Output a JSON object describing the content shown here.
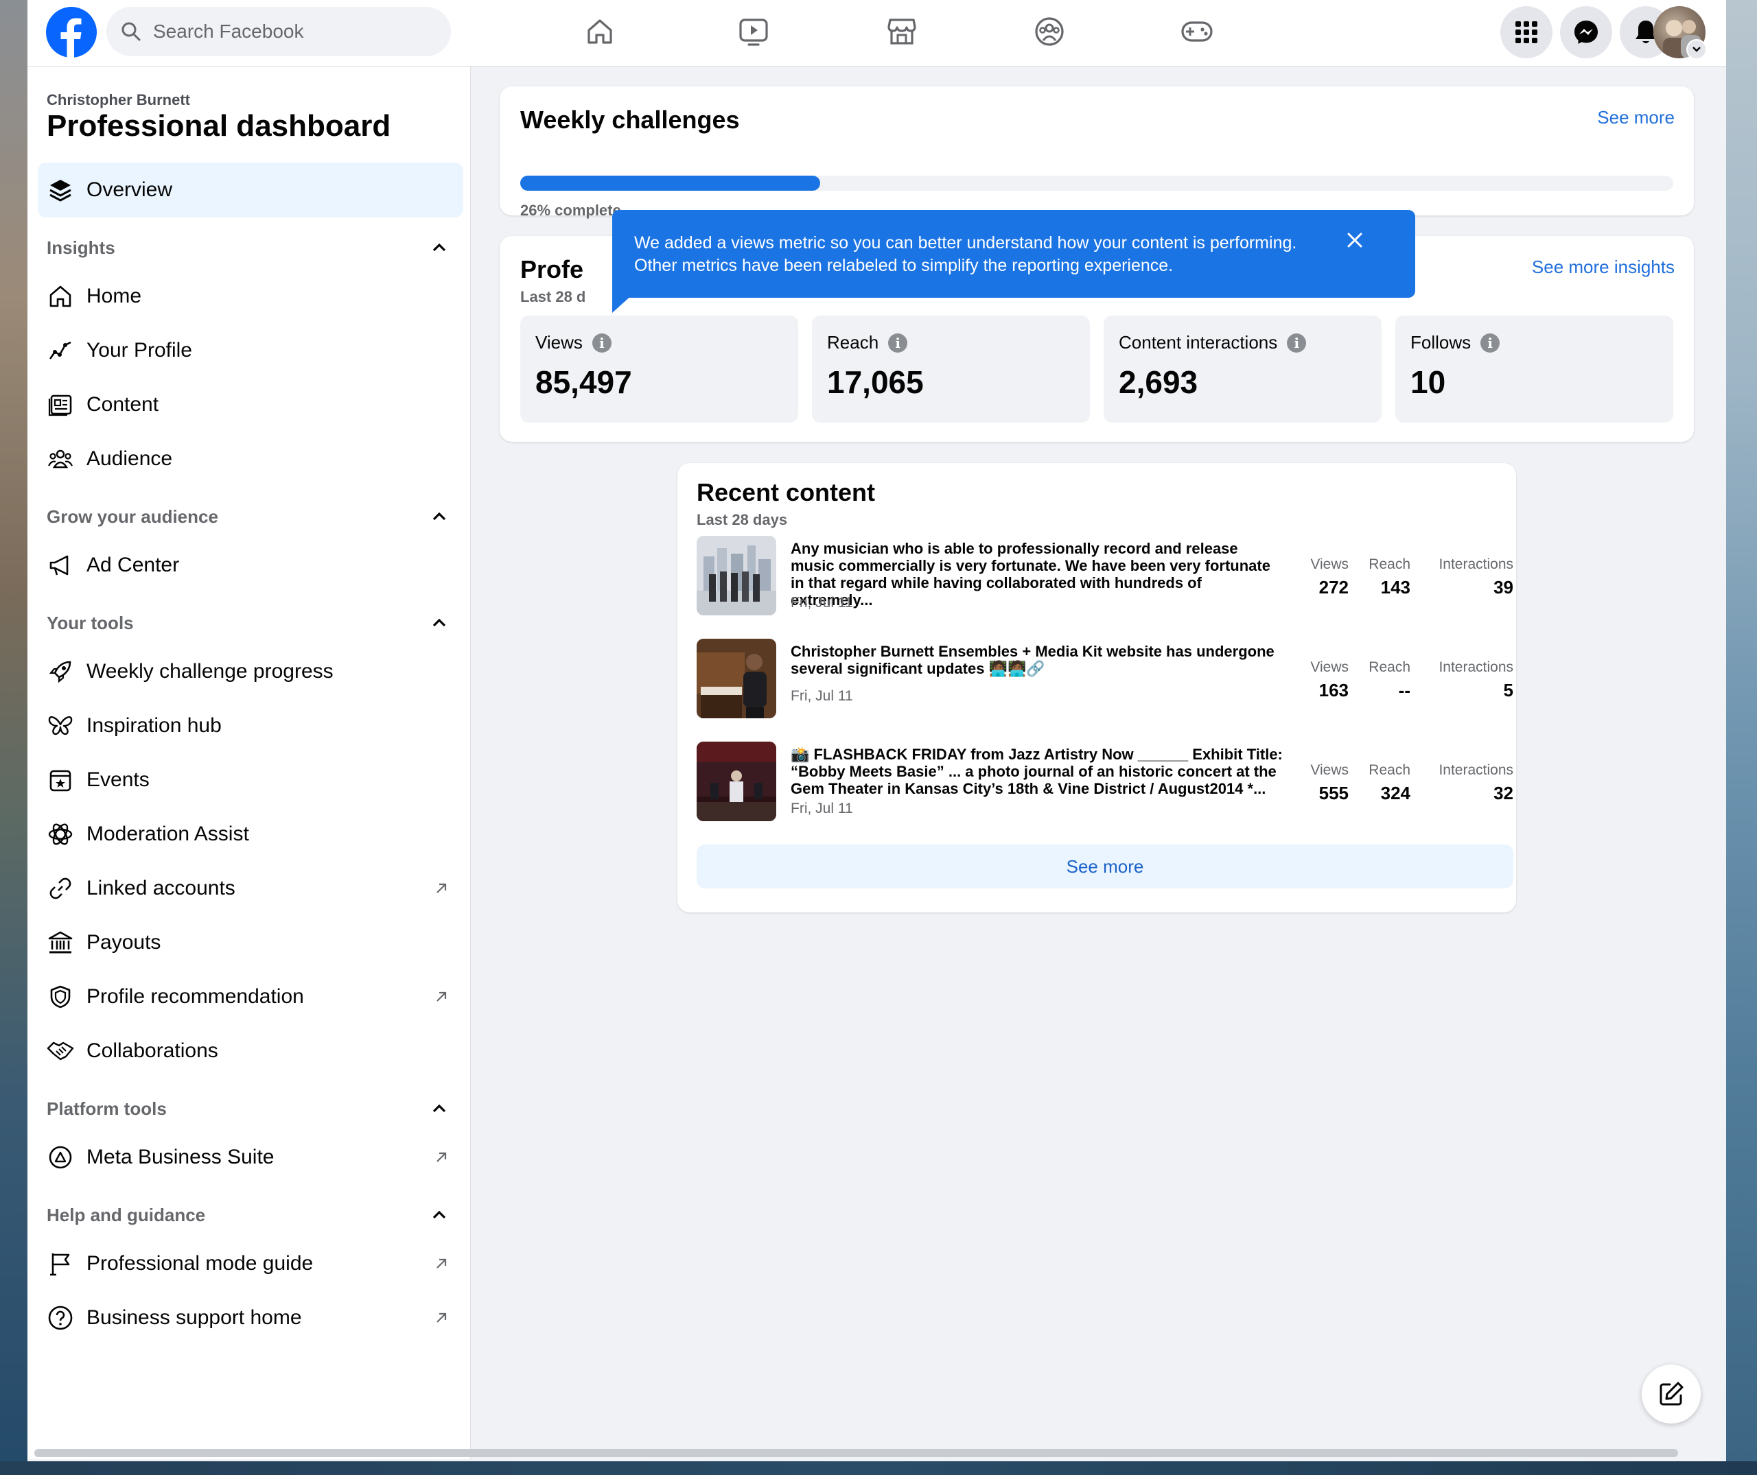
{
  "header": {
    "search_placeholder": "Search Facebook",
    "nav": [
      "home-icon",
      "video-icon",
      "marketplace-icon",
      "groups-icon",
      "gaming-icon"
    ],
    "actions": [
      "menu-icon",
      "messenger-icon",
      "notifications-icon",
      "account-avatar"
    ]
  },
  "sidebar": {
    "owner": "Christopher Burnett",
    "title": "Professional dashboard",
    "overview": "Overview",
    "sections": {
      "insights": "Insights",
      "grow": "Grow your audience",
      "tools": "Your tools",
      "platform": "Platform tools",
      "help": "Help and guidance"
    },
    "items": {
      "home": "Home",
      "profile": "Your Profile",
      "content": "Content",
      "audience": "Audience",
      "ad_center": "Ad Center",
      "weekly": "Weekly challenge progress",
      "inspiration": "Inspiration hub",
      "events": "Events",
      "moderation": "Moderation Assist",
      "linked": "Linked accounts",
      "payouts": "Payouts",
      "recommendation": "Profile recommendation",
      "collaborations": "Collaborations",
      "mbs": "Meta Business Suite",
      "guide": "Professional mode guide",
      "support": "Business support home"
    }
  },
  "weekly": {
    "title": "Weekly challenges",
    "see_more": "See more",
    "progress_pct": 26,
    "progress_text": "26% complete"
  },
  "insights": {
    "title": "Profe",
    "subtitle": "Last 28 d",
    "see_more": "See more insights",
    "metrics": [
      {
        "label": "Views",
        "value": "85,497"
      },
      {
        "label": "Reach",
        "value": "17,065"
      },
      {
        "label": "Content interactions",
        "value": "2,693"
      },
      {
        "label": "Follows",
        "value": "10"
      }
    ]
  },
  "tooltip": {
    "text": "We added a views metric so you can better understand how your content is performing. Other metrics have been relabeled to simplify the reporting experience."
  },
  "recent": {
    "title": "Recent content",
    "subtitle": "Last 28 days",
    "labels": {
      "views": "Views",
      "reach": "Reach",
      "interactions": "Interactions"
    },
    "posts": [
      {
        "text": "Any musician who is able to professionally record and release music commercially is very fortunate. We have been very fortunate in that regard while having collaborated with hundreds of extremely...",
        "date": "Fri, Jul 11",
        "views": "272",
        "reach": "143",
        "interactions": "39"
      },
      {
        "text": "Christopher Burnett Ensembles + Media Kit website has undergone several significant updates 🧑🏾‍💻🧑🏾‍💻🔗",
        "date": "Fri, Jul 11",
        "views": "163",
        "reach": "--",
        "interactions": "5"
      },
      {
        "text": "📸 FLASHBACK FRIDAY from Jazz Artistry Now ______ Exhibit Title: “Bobby Meets Basie” ... a photo journal of an historic concert at the Gem Theater in Kansas City’s 18th & Vine District / August2014 *...",
        "date": "Fri, Jul 11",
        "views": "555",
        "reach": "324",
        "interactions": "32"
      }
    ],
    "see_more": "See more"
  },
  "colors": {
    "brand": "#1b74e4",
    "link": "#216fdb",
    "bg": "#f0f2f5"
  }
}
